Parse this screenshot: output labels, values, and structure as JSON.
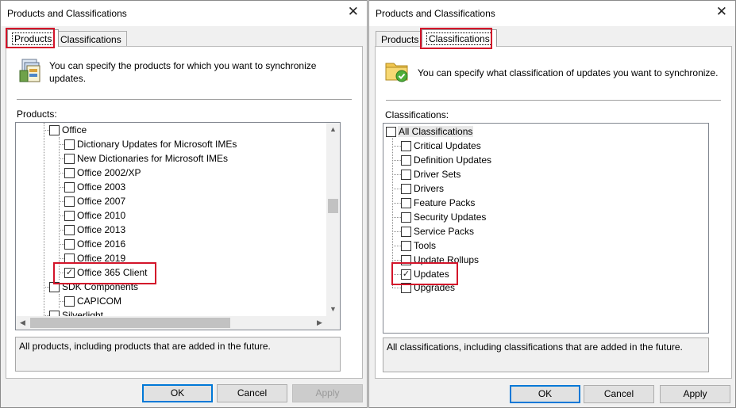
{
  "products_dialog": {
    "title": "Products and Classifications",
    "tabs": [
      {
        "label": "Products",
        "active": true
      },
      {
        "label": "Classifications",
        "active": false
      }
    ],
    "description": "You can specify the products for which you want to synchronize updates.",
    "list_label": "Products:",
    "tree": [
      {
        "label": "Office",
        "checked": false,
        "level": 0
      },
      {
        "label": "Dictionary Updates for Microsoft IMEs",
        "checked": false,
        "level": 1
      },
      {
        "label": "New Dictionaries for Microsoft IMEs",
        "checked": false,
        "level": 1
      },
      {
        "label": "Office 2002/XP",
        "checked": false,
        "level": 1
      },
      {
        "label": "Office 2003",
        "checked": false,
        "level": 1
      },
      {
        "label": "Office 2007",
        "checked": false,
        "level": 1
      },
      {
        "label": "Office 2010",
        "checked": false,
        "level": 1
      },
      {
        "label": "Office 2013",
        "checked": false,
        "level": 1
      },
      {
        "label": "Office 2016",
        "checked": false,
        "level": 1
      },
      {
        "label": "Office 2019",
        "checked": false,
        "level": 1
      },
      {
        "label": "Office 365 Client",
        "checked": true,
        "level": 1
      },
      {
        "label": "SDK Components",
        "checked": false,
        "level": 0
      },
      {
        "label": "CAPICOM",
        "checked": false,
        "level": 1
      },
      {
        "label": "Silverlight",
        "checked": false,
        "level": 0
      }
    ],
    "info": "All products, including products that are added in the future.",
    "buttons": {
      "ok": "OK",
      "cancel": "Cancel",
      "apply": "Apply"
    }
  },
  "classifications_dialog": {
    "title": "Products and Classifications",
    "tabs": [
      {
        "label": "Products",
        "active": false
      },
      {
        "label": "Classifications",
        "active": true
      }
    ],
    "description": "You can specify what classification of updates you want to synchronize.",
    "list_label": "Classifications:",
    "tree": [
      {
        "label": "All Classifications",
        "checked": false,
        "level": 0
      },
      {
        "label": "Critical Updates",
        "checked": false,
        "level": 1
      },
      {
        "label": "Definition Updates",
        "checked": false,
        "level": 1
      },
      {
        "label": "Driver Sets",
        "checked": false,
        "level": 1
      },
      {
        "label": "Drivers",
        "checked": false,
        "level": 1
      },
      {
        "label": "Feature Packs",
        "checked": false,
        "level": 1
      },
      {
        "label": "Security Updates",
        "checked": false,
        "level": 1
      },
      {
        "label": "Service Packs",
        "checked": false,
        "level": 1
      },
      {
        "label": "Tools",
        "checked": false,
        "level": 1
      },
      {
        "label": "Update Rollups",
        "checked": false,
        "level": 1
      },
      {
        "label": "Updates",
        "checked": true,
        "level": 1
      },
      {
        "label": "Upgrades",
        "checked": false,
        "level": 1
      }
    ],
    "info": "All classifications, including classifications that are added in the future.",
    "buttons": {
      "ok": "OK",
      "cancel": "Cancel",
      "apply": "Apply"
    }
  },
  "colors": {
    "highlight": "#d3142a",
    "default_button_border": "#0078d7",
    "dialog_bg": "#f0f0f0"
  }
}
